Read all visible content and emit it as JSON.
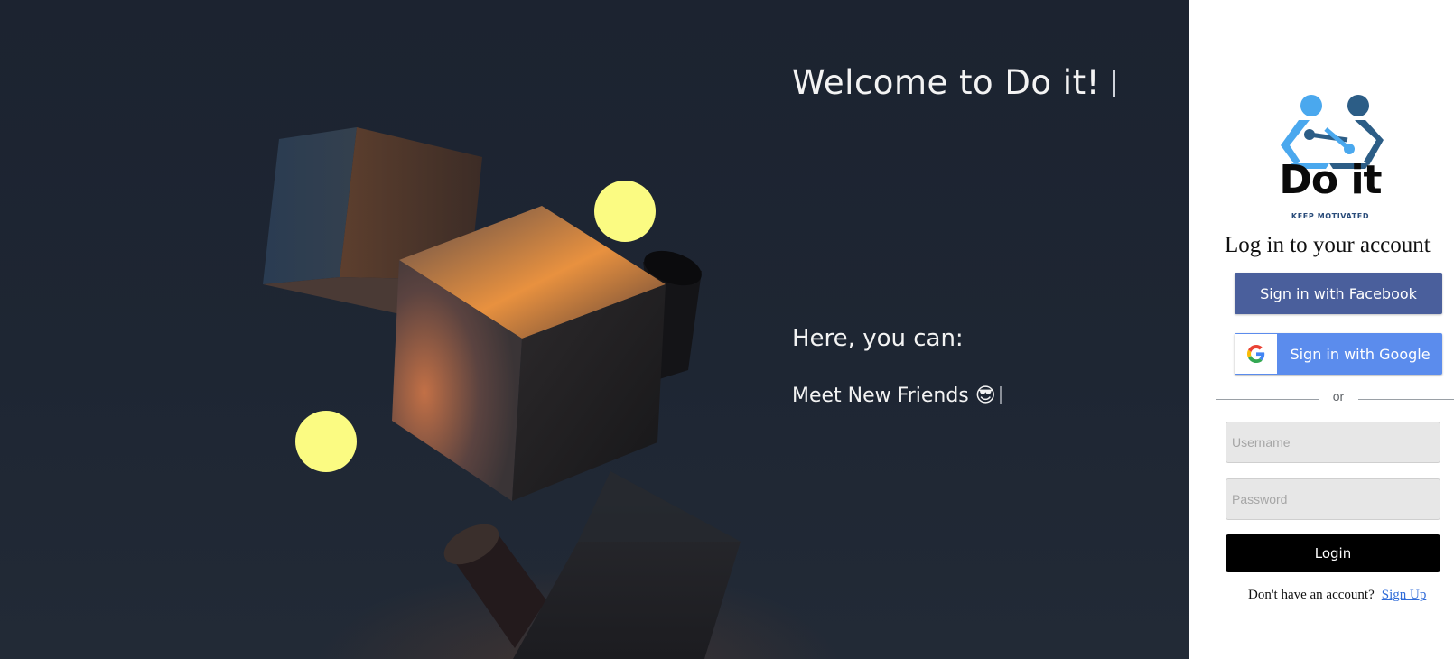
{
  "hero": {
    "title": "Welcome to Do it!",
    "subtitle": "Here, you can:",
    "typed_text": "Meet New Friends 😎"
  },
  "brand": {
    "name": "Do it",
    "tagline": "KEEP MOTIVATED",
    "logo_icon": "people-connection-icon",
    "colors": {
      "light_blue": "#4aa8ee",
      "dark_blue": "#2c5d86"
    }
  },
  "login": {
    "heading": "Log in to your account",
    "facebook_button": "Sign in with Facebook",
    "google_button": "Sign in with Google",
    "google_icon": "google-g-icon",
    "divider_text": "or",
    "username_placeholder": "Username",
    "password_placeholder": "Password",
    "login_button": "Login",
    "no_account_text": "Don't have an account?",
    "signup_link": "Sign Up"
  },
  "colors": {
    "hero_background": "#1e2633",
    "facebook_blue": "#4a5f9c",
    "google_blue": "#5b8ced",
    "login_button": "#000000",
    "link_blue": "#2f6bd8"
  }
}
